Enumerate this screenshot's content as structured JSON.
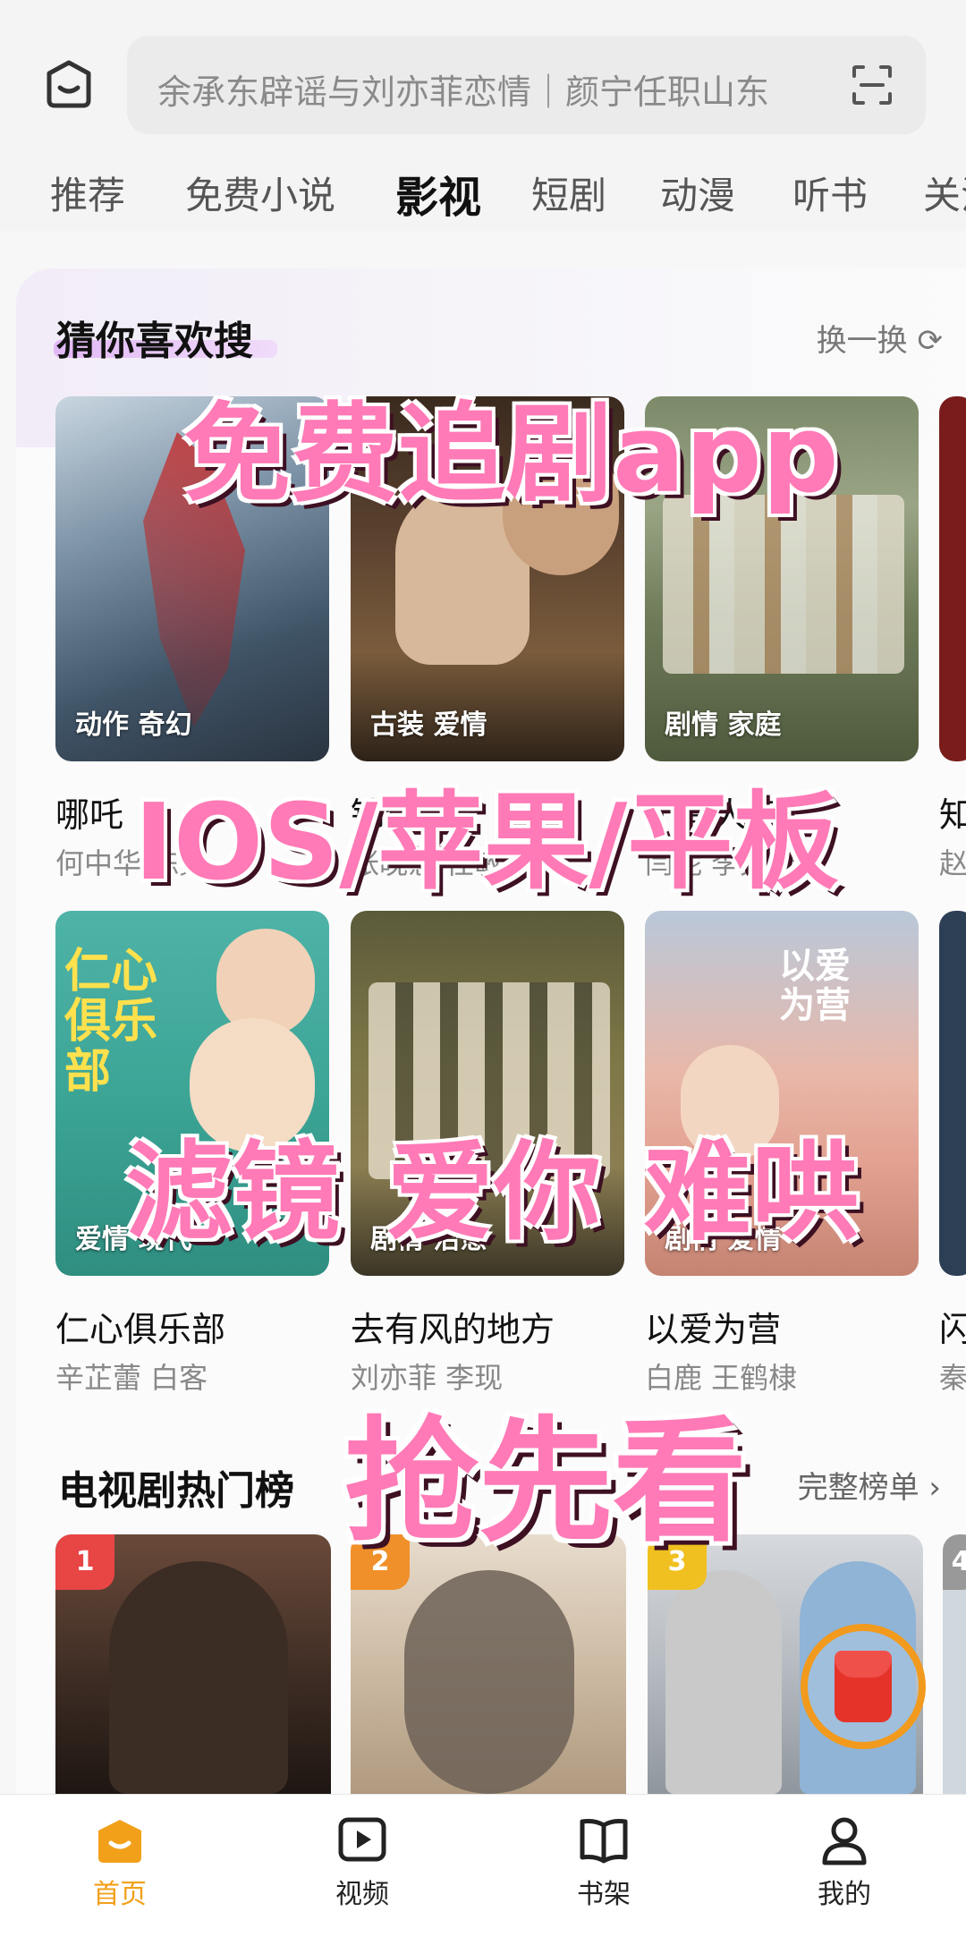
{
  "search": {
    "placeholder_text": "余承东辟谣与刘亦菲恋情｜颜宁任职山东"
  },
  "tabs": [
    "推荐",
    "免费小说",
    "影视",
    "短剧",
    "动漫",
    "听书",
    "关注"
  ],
  "active_tab": "影视",
  "guess_section": {
    "title": "猜你喜欢搜",
    "refresh_label": "换一换",
    "items": [
      {
        "title": "哪吒",
        "cast": "何中华 陈数",
        "tags": "动作 奇幻"
      },
      {
        "title": "锦绣安宁",
        "cast": "张晚意 任敏",
        "tags": "古装 爱情"
      },
      {
        "title": "小巷人家",
        "cast": "闫妮 李光洁",
        "tags": "剧情 家庭"
      },
      {
        "title": "知",
        "cast": "赵",
        "tags": ""
      },
      {
        "title": "仁心俱乐部",
        "cast": "辛芷蕾 白客",
        "tags": "爱情 现代"
      },
      {
        "title": "去有风的地方",
        "cast": "刘亦菲 李现",
        "tags": "剧情 治愈"
      },
      {
        "title": "以爱为营",
        "cast": "白鹿 王鹤棣",
        "tags": "剧情 爱情"
      },
      {
        "title": "闪",
        "cast": "秦",
        "tags": ""
      }
    ]
  },
  "hot_section": {
    "title": "电视剧热门榜",
    "more_label": "完整榜单",
    "ranks": [
      "1",
      "2",
      "3",
      "4"
    ]
  },
  "promo_overlay": {
    "line1": "免费追剧app",
    "line2": "IOS/苹果/平板",
    "line3a": "滤镜",
    "line3b": "爱你",
    "line3c": "难哄",
    "line4": "抢先看"
  },
  "bottom_nav": {
    "items": [
      {
        "label": "首页",
        "icon": "home-icon",
        "active": true
      },
      {
        "label": "视频",
        "icon": "video-play-icon",
        "active": false
      },
      {
        "label": "书架",
        "icon": "book-icon",
        "active": false
      },
      {
        "label": "我的",
        "icon": "user-icon",
        "active": false
      }
    ]
  },
  "colors": {
    "accent": "#f2a01a",
    "promo_pink": "#e8559a",
    "rank1": "#e84545",
    "rank2": "#f0902a",
    "rank3": "#f0c020"
  }
}
